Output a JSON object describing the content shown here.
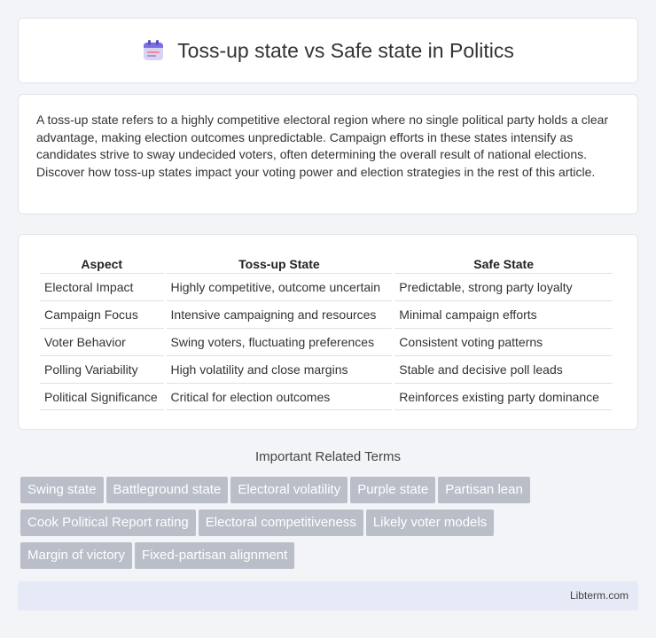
{
  "header": {
    "title": "Toss-up state vs Safe state in Politics",
    "icon": "calendar-icon"
  },
  "intro": {
    "text": "A toss-up state refers to a highly competitive electoral region where no single political party holds a clear advantage, making election outcomes unpredictable. Campaign efforts in these states intensify as candidates strive to sway undecided voters, often determining the overall result of national elections. Discover how toss-up states impact your voting power and election strategies in the rest of this article."
  },
  "table": {
    "headers": [
      "Aspect",
      "Toss-up State",
      "Safe State"
    ],
    "rows": [
      [
        "Electoral Impact",
        "Highly competitive, outcome uncertain",
        "Predictable, strong party loyalty"
      ],
      [
        "Campaign Focus",
        "Intensive campaigning and resources",
        "Minimal campaign efforts"
      ],
      [
        "Voter Behavior",
        "Swing voters, fluctuating preferences",
        "Consistent voting patterns"
      ],
      [
        "Polling Variability",
        "High volatility and close margins",
        "Stable and decisive poll leads"
      ],
      [
        "Political Significance",
        "Critical for election outcomes",
        "Reinforces existing party dominance"
      ]
    ]
  },
  "related": {
    "title": "Important Related Terms",
    "tags": [
      "Swing state",
      "Battleground state",
      "Electoral volatility",
      "Purple state",
      "Partisan lean",
      "Cook Political Report rating",
      "Electoral competitiveness",
      "Likely voter models",
      "Margin of victory",
      "Fixed-partisan alignment"
    ]
  },
  "footer": {
    "brand": "Libterm.com"
  },
  "colors": {
    "page_bg": "#f3f4f8",
    "tag_bg": "#b9bec9",
    "footer_bg": "#e5eaf6",
    "icon_accent": "#7b6ee0"
  }
}
